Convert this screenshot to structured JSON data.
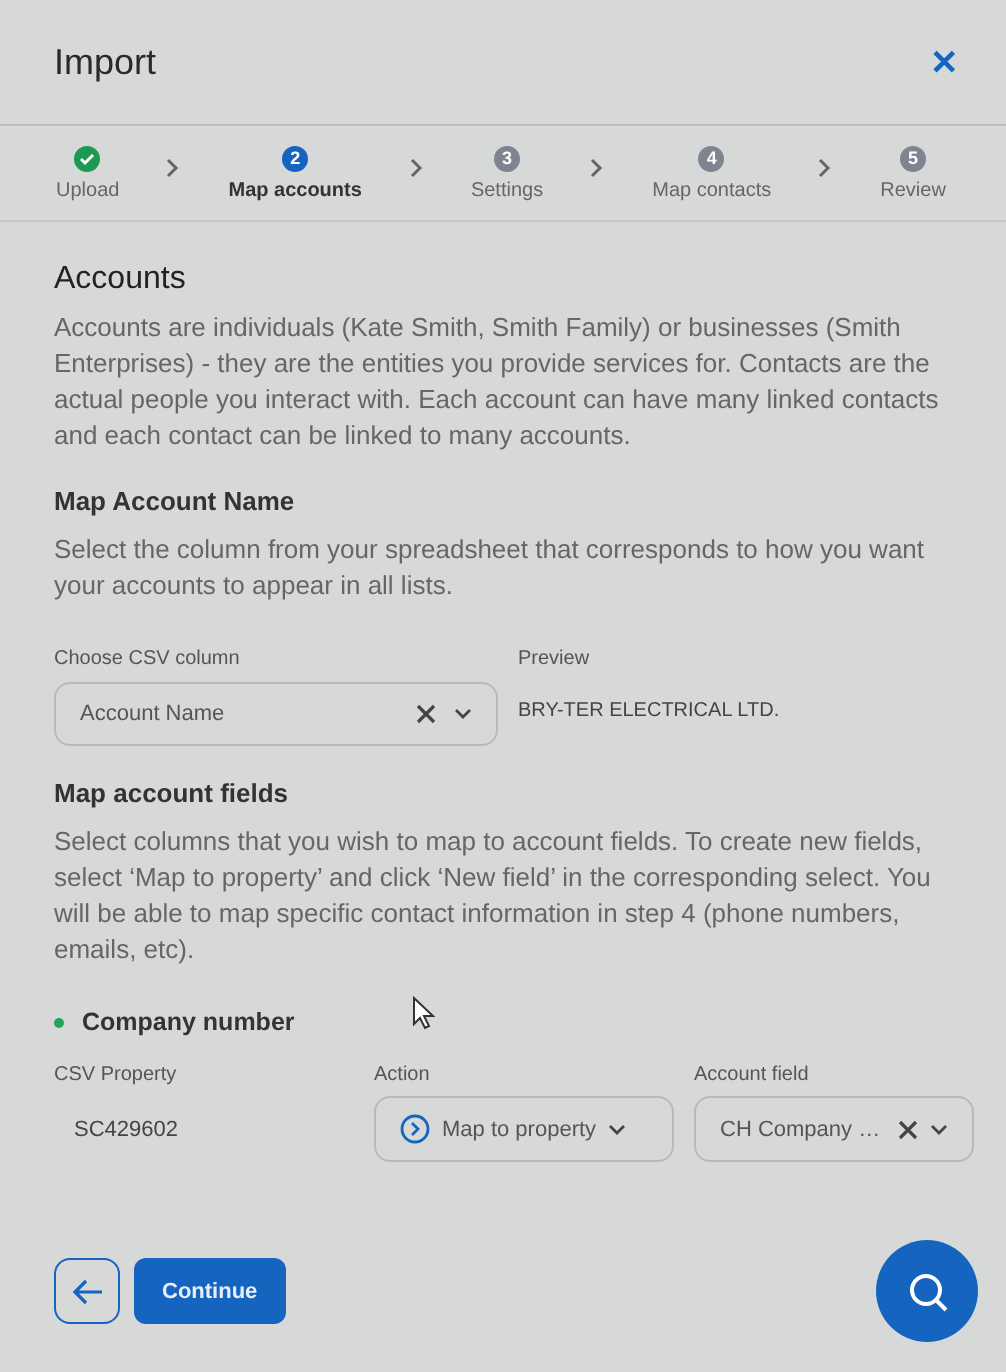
{
  "dialog": {
    "title": "Import",
    "close": "✕"
  },
  "steps": [
    {
      "label": "Upload",
      "done": true,
      "selected": false
    },
    {
      "number": "2",
      "label": "Map accounts",
      "done": false,
      "selected": true
    },
    {
      "number": "3",
      "label": "Settings",
      "done": false,
      "selected": false
    },
    {
      "number": "4",
      "label": "Map contacts",
      "done": false,
      "selected": false
    },
    {
      "number": "5",
      "label": "Review",
      "done": false,
      "selected": false
    }
  ],
  "heading": "Accounts",
  "intro": "Accounts are individuals (Kate Smith, Smith Family) or businesses (Smith Enterprises) - they are the entities you provide services for. Contacts are the actual people you interact with. Each account can have many linked contacts and each contact can be linked to many accounts.",
  "name_section": {
    "title": "Map Account Name",
    "text": "Select the column from your spreadsheet that corresponds to how you want your accounts to appear in all lists.",
    "column_label": "Choose CSV column",
    "column_value": "Account Name",
    "preview_label": "Preview",
    "preview_value": "BRY-TER ELECTRICAL LTD."
  },
  "fields_section": {
    "title": "Map account fields",
    "text": "Select columns that you wish to map to account fields. To create new fields, select ‘Map to property’ and click ‘New field’ in the corresponding select. You will be able to map specific contact information in step 4 (phone numbers, emails, etc)."
  },
  "mappings": [
    {
      "name": "Company number",
      "color": "#22a35a",
      "csv_label": "CSV Property",
      "csv_value": "SC429602",
      "action_label": "Action",
      "action_value": "Map to property",
      "field_label": "Account field",
      "field_value": "CH Company …"
    }
  ],
  "footer": {
    "continue": "Continue"
  }
}
